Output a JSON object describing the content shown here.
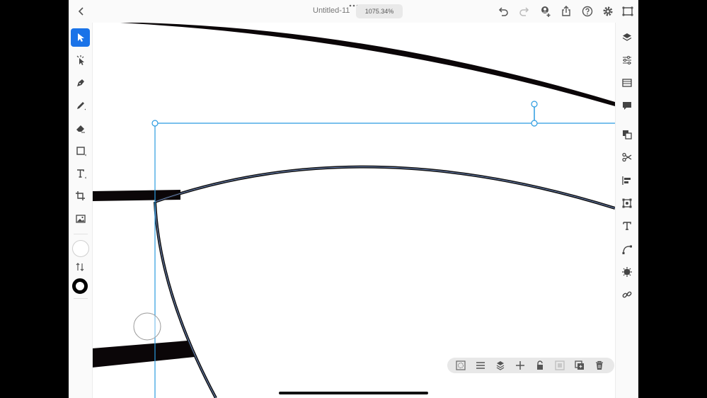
{
  "document": {
    "title": "Untitled-11",
    "zoom": "1075.34%"
  },
  "top_bar": {
    "left_icons": [
      "back-chevron-icon"
    ],
    "right_icons": [
      "undo-icon",
      "redo-icon",
      "invite-user-icon",
      "share-icon",
      "help-icon",
      "settings-icon",
      "cloud-sync-icon"
    ]
  },
  "left_toolbar": {
    "tools": [
      {
        "name": "selection-tool",
        "icon": "arrow-pointer-icon",
        "active": true
      },
      {
        "name": "direct-selection-tool",
        "icon": "direct-select-icon",
        "active": false
      },
      {
        "name": "pen-tool",
        "icon": "pen-nib-icon",
        "active": false
      },
      {
        "name": "pencil-tool",
        "icon": "pencil-icon",
        "active": false
      },
      {
        "name": "eraser-tool",
        "icon": "eraser-icon",
        "active": false
      },
      {
        "name": "rectangle-tool",
        "icon": "rectangle-icon",
        "active": false
      },
      {
        "name": "type-tool",
        "icon": "type-t-icon",
        "active": false
      },
      {
        "name": "crop-tool",
        "icon": "crop-icon",
        "active": false
      },
      {
        "name": "place-image-tool",
        "icon": "image-icon",
        "active": false
      }
    ],
    "fill_color": "#ffffff",
    "stroke_color": "#000000",
    "swap_icon": "swap-arrows-icon"
  },
  "right_panel": {
    "icons": [
      "layers-icon",
      "properties-icon",
      "appearance-icon",
      "comments-icon",
      "pathfinder-icon",
      "scissors-icon",
      "align-icon",
      "transform-icon",
      "type-icon",
      "curve-icon",
      "effects-icon",
      "link-icon"
    ]
  },
  "action_bar": {
    "icons": [
      "mask-icon",
      "align-menu-icon",
      "arrange-icon",
      "move-icon",
      "lock-icon",
      "group-icon",
      "duplicate-icon",
      "delete-icon"
    ]
  },
  "colors": {
    "accent": "#1a73e8",
    "selection_blue": "#2b9be0"
  }
}
